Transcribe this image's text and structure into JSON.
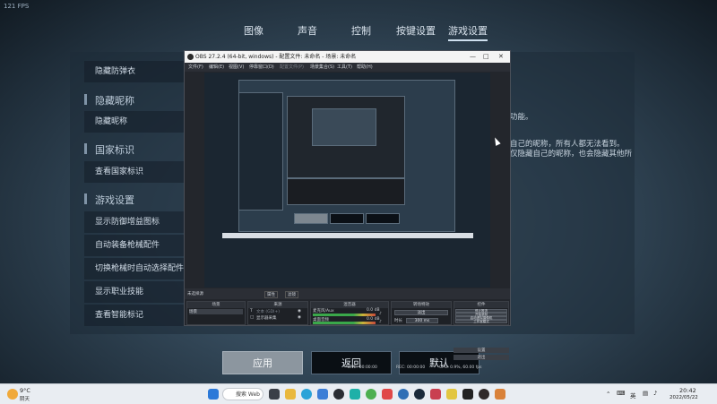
{
  "fps_label": "121 FPS",
  "tabs": [
    {
      "label": "图像"
    },
    {
      "label": "声音"
    },
    {
      "label": "控制"
    },
    {
      "label": "按键设置"
    },
    {
      "label": "游戏设置"
    }
  ],
  "settings": {
    "hide_grenade": "隐藏防弹衣",
    "section_nickname": "隐藏昵称",
    "hide_nickname": "隐藏昵称",
    "section_country": "国家标识",
    "view_country": "查看国家标识",
    "section_game": "游戏设置",
    "show_buff": "显示防御增益图标",
    "auto_equip": "自动装备枪械配件",
    "auto_select": "切换枪械时自动选择配件",
    "show_job": "显示职业技能",
    "smart_mark": "查看智能标记",
    "right_text_1": "功能。",
    "right_text_2": "自己的昵称，所有人都无法看到。",
    "right_text_3": "仅隐藏自己的昵称，也会隐藏其他所"
  },
  "buttons": {
    "apply": "应用",
    "back": "返回",
    "default": "默认"
  },
  "obs": {
    "title": "OBS 27.2.4 (64-bit, windows) - 配置文件: 未命名 - 场景: 未命名",
    "menu": [
      "文件(F)",
      "编辑(E)",
      "视图(V)",
      "停靠窗口(D)",
      "配置文件(P)",
      "场景集合(S)",
      "工具(T)",
      "帮助(H)"
    ],
    "no_source": "未选择源",
    "props_btn": "属性",
    "filters_btn": "滤镜",
    "docks": {
      "scenes": "场景",
      "sources": "来源",
      "mixer": "混音器",
      "transitions": "转场特效",
      "controls": "控件"
    },
    "scene_item": "场景",
    "source_items": [
      "文本 (GDI+)",
      "显示器采集"
    ],
    "mixer": [
      {
        "name": "麦克风/Aux",
        "db": "0.0 dB"
      },
      {
        "name": "桌面音频",
        "db": "0.0 dB"
      }
    ],
    "transition": {
      "type": "淡出",
      "duration_label": "时长",
      "duration_value": "300 ms"
    },
    "controls": [
      "停止推流",
      "开始录制",
      "启动虚拟摄像机",
      "工作室模式",
      "设置",
      "退出"
    ],
    "status": {
      "live": "LIVE: 00:00:00",
      "rec": "REC: 00:00:00",
      "cpu": "CPU: 0.9%, 60.00 fps"
    }
  },
  "taskbar": {
    "weather_temp": "9°C",
    "weather_desc": "阴天",
    "search": "搜索 Web",
    "lang": "英",
    "time": "20:42",
    "date": "2022/05/22"
  }
}
